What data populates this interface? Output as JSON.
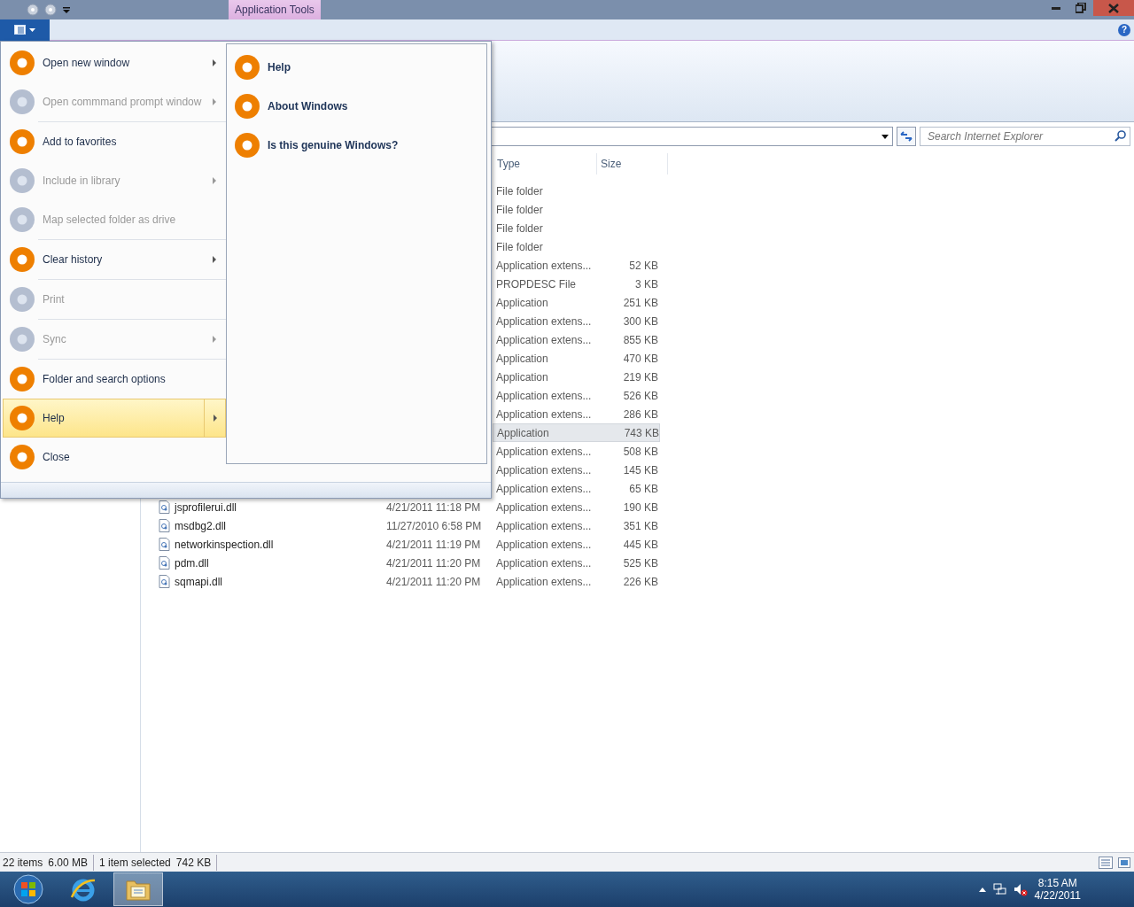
{
  "title_bar": {
    "contextual_tab": "Application Tools"
  },
  "ribbon_tabs": {
    "help_glyph": "?"
  },
  "search": {
    "placeholder": "Search Internet Explorer"
  },
  "columns": [
    {
      "label": "Type"
    },
    {
      "label": "Size"
    }
  ],
  "rows": [
    {
      "type": "File folder",
      "selected": false
    },
    {
      "type": "File folder",
      "selected": false
    },
    {
      "type": "File folder",
      "selected": false
    },
    {
      "type": "File folder",
      "selected": false
    },
    {
      "type": "Application extens...",
      "size": "52 KB",
      "selected": false
    },
    {
      "type": "PROPDESC File",
      "size": "3 KB",
      "selected": false
    },
    {
      "type": "Application",
      "size": "251 KB",
      "selected": false
    },
    {
      "type": "Application extens...",
      "size": "300 KB",
      "selected": false
    },
    {
      "type": "Application extens...",
      "size": "855 KB",
      "selected": false
    },
    {
      "type": "Application",
      "size": "470 KB",
      "selected": false
    },
    {
      "type": "Application",
      "size": "219 KB",
      "selected": false
    },
    {
      "type": "Application extens...",
      "size": "526 KB",
      "selected": false
    },
    {
      "type": "Application extens...",
      "size": "286 KB",
      "selected": false
    },
    {
      "type": "Application",
      "size": "743 KB",
      "selected": true
    },
    {
      "type": "Application extens...",
      "size": "508 KB",
      "selected": false
    },
    {
      "type": "Application extens...",
      "size": "145 KB",
      "selected": false
    },
    {
      "type": "Application extens...",
      "size": "65 KB",
      "selected": false
    },
    {
      "name": "jsprofilerui.dll",
      "date": "4/21/2011 11:18 PM",
      "type": "Application extens...",
      "size": "190 KB",
      "selected": false
    },
    {
      "name": "msdbg2.dll",
      "date": "11/27/2010 6:58 PM",
      "type": "Application extens...",
      "size": "351 KB",
      "selected": false
    },
    {
      "name": "networkinspection.dll",
      "date": "4/21/2011 11:19 PM",
      "type": "Application extens...",
      "size": "445 KB",
      "selected": false
    },
    {
      "name": "pdm.dll",
      "date": "4/21/2011 11:20 PM",
      "type": "Application extens...",
      "size": "525 KB",
      "selected": false
    },
    {
      "name": "sqmapi.dll",
      "date": "4/21/2011 11:20 PM",
      "type": "Application extens...",
      "size": "226 KB",
      "selected": false
    }
  ],
  "menu": {
    "groups": [
      [
        {
          "label": "Open new window",
          "disabled": false,
          "submenu": true,
          "selected": false
        },
        {
          "label": "Open commmand prompt window",
          "disabled": true,
          "submenu": true,
          "selected": false
        }
      ],
      [
        {
          "label": "Add to favorites",
          "disabled": false,
          "submenu": false,
          "selected": false
        },
        {
          "label": "Include in library",
          "disabled": true,
          "submenu": true,
          "selected": false
        },
        {
          "label": "Map selected folder as drive",
          "disabled": true,
          "submenu": false,
          "selected": false
        }
      ],
      [
        {
          "label": "Clear history",
          "disabled": false,
          "submenu": true,
          "selected": false
        }
      ],
      [
        {
          "label": "Print",
          "disabled": true,
          "submenu": false,
          "selected": false
        }
      ],
      [
        {
          "label": "Sync",
          "disabled": true,
          "submenu": true,
          "selected": false
        }
      ],
      [
        {
          "label": "Folder and search options",
          "disabled": false,
          "submenu": false,
          "selected": false
        },
        {
          "label": "Help",
          "disabled": false,
          "submenu": true,
          "selected": true
        },
        {
          "label": "Close",
          "disabled": false,
          "submenu": false,
          "selected": false
        }
      ]
    ],
    "submenu": [
      {
        "label": "Help"
      },
      {
        "label": "About Windows"
      },
      {
        "label": "Is this genuine Windows?"
      }
    ]
  },
  "status_bar": [
    {
      "text": "22 items"
    },
    {
      "text": "6.00 MB"
    },
    {
      "text": "1 item selected"
    },
    {
      "text": "742 KB"
    }
  ],
  "clock": {
    "time": "8:15 AM",
    "date": "4/22/2011"
  }
}
